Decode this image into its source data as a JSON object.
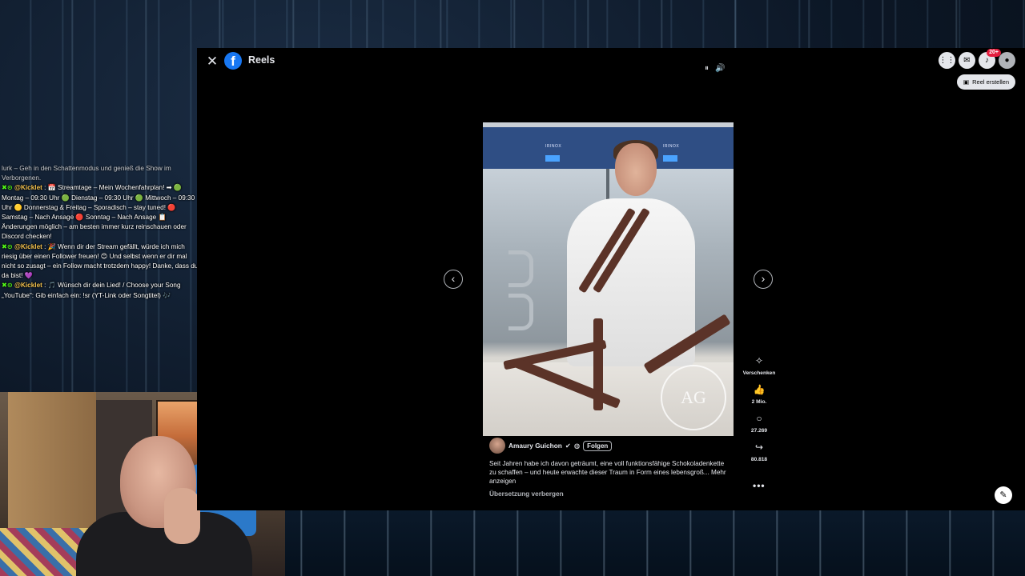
{
  "chat": {
    "lines": [
      {
        "text": "lurk – Geh in den Schattenmodus und genieß die Show im Verborgenen."
      },
      {
        "badge": "✖⊙",
        "name": "@Kicklet",
        "text": ": 📅 Streamtage – Mein Wochenfahrplan! ➡ 🟢 Montag – 09:30 Uhr 🟢 Dienstag – 09:30 Uhr 🟢 Mittwoch – 09:30 Uhr 🟡 Donnerstag & Freitag – Sporadisch – stay tuned! 🔴 Samstag – Nach Ansage 🔴 Sonntag – Nach Ansage 📋 Änderungen möglich – am besten immer kurz reinschauen oder Discord checken!"
      },
      {
        "badge": "✖⊙",
        "name": "@Kicklet",
        "text": ": 🎉 Wenn dir der Stream gefällt, würde ich mich riesig über einen Follower freuen! 😊 Und selbst wenn er dir mal nicht so zusagt – ein Follow macht trotzdem happy! Danke, dass du da bist! 💜"
      },
      {
        "badge": "✖⊙",
        "name": "@Kicklet",
        "text": ": 🎵 Wünsch dir dein Lied! / Choose your Song „YouTube\": Gib einfach ein: !sr (YT-Link oder Songtitel) 🎶"
      }
    ]
  },
  "fb": {
    "title": "Reels",
    "logo": "f",
    "close_icon": "close-icon",
    "pause_glyph": "⏸",
    "volume_glyph": "🔊",
    "header_icons": [
      "grid-menu-icon",
      "messenger-icon",
      "bell-icon",
      "account-avatar"
    ],
    "notifications_badge": "20+",
    "reel_create_label": "Reel erstellen",
    "prev_glyph": "‹",
    "next_glyph": "›"
  },
  "video": {
    "brand_left": "IRINOX",
    "brand_right": "IRINOX",
    "stamp": "AG"
  },
  "reel": {
    "author": "Amaury Guichon",
    "verified_glyph": "✔",
    "follow_label": "Folgen",
    "caption": "Seit Jahren habe ich davon geträumt, eine voll funktionsfähige Schokoladenkette zu schaffen – und heute erwachte dieser Traum in Form eines lebensgroß... Mehr anzeigen",
    "translation_toggle": "Übersetzung verbergen"
  },
  "actions": {
    "gift_label": "Verschenken",
    "like_count": "2 Mio.",
    "comment_count": "27.269",
    "share_count": "80.818",
    "more_glyph": "•••"
  }
}
